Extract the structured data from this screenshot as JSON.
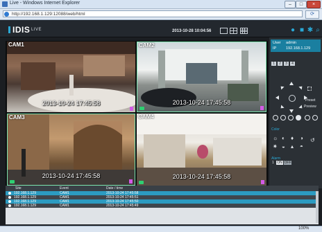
{
  "browser": {
    "title": "Live - Windows Internet Explorer",
    "url": "http://192.168.1.129:12088/web/html",
    "zoom": "100%",
    "window_buttons": [
      "–",
      "□",
      "×"
    ]
  },
  "header": {
    "logo": "IDIS",
    "logo_sub": "LIVE",
    "datetime": "2013-10-28 10:04:56"
  },
  "cameras": [
    {
      "label": "CAM1",
      "timestamp": "2013-10-24 17:45:58"
    },
    {
      "label": "CAM2",
      "timestamp": "2013-10-24 17:45:58"
    },
    {
      "label": "CAM3",
      "timestamp": "2013-10-24 17:45:58"
    },
    {
      "label": "CAM4",
      "timestamp": "2013-10-24 17:45:58"
    }
  ],
  "panel": {
    "user_key": "User",
    "user_val": "admin",
    "ip_key": "IP",
    "ip_val": "192.168.1.129",
    "channels": [
      "1",
      "2",
      "3",
      "4"
    ],
    "preset": "Preset",
    "preview": "Preview",
    "color_title": "Color",
    "alarm_title": "Alarm",
    "alarm_on": "ON",
    "alarm_off": "OFF"
  },
  "log": {
    "columns": [
      "Site",
      "Event",
      "Date / time"
    ],
    "rows": [
      {
        "site": "192.168.1.129",
        "event": "CAM1",
        "time": "2013-10-24 17:45:58",
        "bg": "#2c9bc1"
      },
      {
        "site": "192.168.1.129",
        "event": "CAM1",
        "time": "2013-10-24 17:45:51",
        "bg": "#3f464d"
      },
      {
        "site": "192.168.1.129",
        "event": "CAM1",
        "time": "2013-10-24 17:45:50",
        "bg": "#2c9bc1"
      },
      {
        "site": "192.168.1.129",
        "event": "CAM1",
        "time": "2013-10-24 17:45:49",
        "bg": "#3f464d"
      }
    ]
  },
  "colors": {
    "accent": "#2aa9d6",
    "selected_border": "#7ce6b0"
  }
}
